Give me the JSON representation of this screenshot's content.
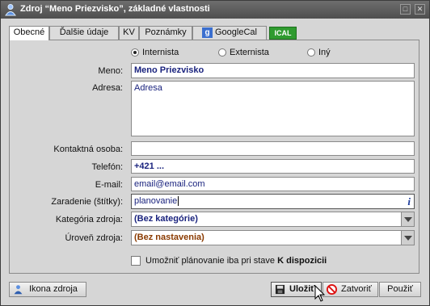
{
  "window": {
    "title": "Zdroj “Meno Priezvisko”, základné vlastnosti"
  },
  "tabs": [
    {
      "label": "Obecné"
    },
    {
      "label": "Ďalšie údaje"
    },
    {
      "label": "KV"
    },
    {
      "label": "Poznámky"
    },
    {
      "label": "GoogleCal"
    }
  ],
  "ical_tab": {
    "label": "ICAL"
  },
  "type_options": [
    {
      "label": "Internista",
      "selected": true
    },
    {
      "label": "Externista",
      "selected": false
    },
    {
      "label": "Iný",
      "selected": false
    }
  ],
  "form": {
    "name": {
      "label": "Meno:",
      "value": "Meno Priezvisko"
    },
    "address": {
      "label": "Adresa:",
      "value": "Adresa"
    },
    "contact": {
      "label": "Kontaktná osoba:",
      "value": ""
    },
    "phone": {
      "label": "Telefón:",
      "value": "+421 ..."
    },
    "email": {
      "label": "E-mail:",
      "value": "email@email.com"
    },
    "tags": {
      "label": "Zaradenie (štítky):",
      "value": "planovanie"
    },
    "category": {
      "label": "Kategória zdroja:",
      "value": "(Bez kategórie)"
    },
    "level": {
      "label": "Úroveň zdroja:",
      "value": "(Bez nastavenia)"
    },
    "planning_checkbox": {
      "label_prefix": "Umožniť plánovanie iba pri stave ",
      "label_bold": "K dispozicii",
      "checked": false
    }
  },
  "buttons": {
    "icon_resource": "Ikona zdroja",
    "save": "Uložiť",
    "close": "Zatvoriť",
    "use": "Použiť"
  },
  "colors": {
    "value_text": "#1a237e",
    "level_text": "#8a3a00",
    "ical": "#2f9b2f"
  }
}
